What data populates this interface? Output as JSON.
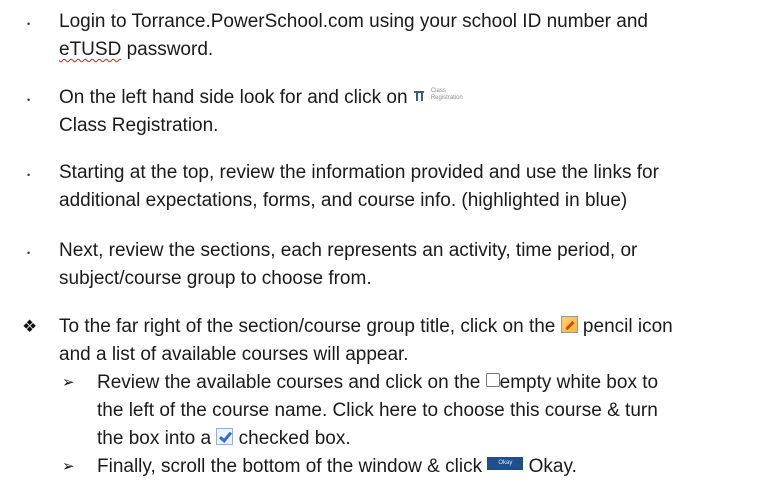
{
  "steps": [
    {
      "bullet": "•",
      "line1": "Login to Torrance.PowerSchool.com using your school ID number and",
      "line2_word": "eTUSD",
      "line2_rest": " password."
    },
    {
      "bullet": "•",
      "line1": "On the left hand side look for and click on ",
      "icon_label": "Class Registration",
      "line2": "Class Registration."
    },
    {
      "bullet": "•",
      "line1": "Starting at the top, review the information provided and use the links for",
      "line2": "additional expectations, forms, and course info. (highlighted in blue)"
    },
    {
      "bullet": "•",
      "line1": "Next, review the sections, each represents an activity, time period, or",
      "line2": "subject/course group to choose from."
    },
    {
      "bullet": "❖",
      "line1_a": "To the far right of the section/course group title, click on the ",
      "line1_b": " pencil icon",
      "line2": "and a list of available courses will appear."
    }
  ],
  "substeps": [
    {
      "bullet": "➢",
      "line1_a": "Review the available courses and click on the ",
      "line1_b": "empty white box to",
      "line2": "the left of the course name. Click here to choose this course & turn",
      "line3_a": "the box into a ",
      "line3_b": " checked box."
    },
    {
      "bullet": "➢",
      "line1_a": "Finally, scroll the bottom of the window & click ",
      "button_label": "Okay",
      "line1_b": " Okay."
    }
  ]
}
